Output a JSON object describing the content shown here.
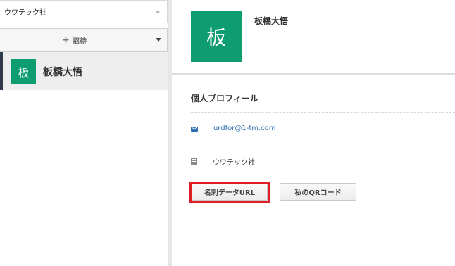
{
  "sidebar": {
    "company_select": {
      "value": "ウワテック社"
    },
    "invite": {
      "label": "招待"
    },
    "members": [
      {
        "initial": "板",
        "name": "板橋大悟",
        "selected": true
      }
    ]
  },
  "profile": {
    "initial": "板",
    "name": "板橋大悟",
    "section_title": "個人プロフィール",
    "email": "urdfor@1-tm.com",
    "company": "ウワテック社",
    "buttons": {
      "card_url": "名刺データURL",
      "qr_code": "私のQRコード"
    }
  },
  "colors": {
    "avatar": "#0d9d70",
    "link": "#2c6db1",
    "highlight": "#e01c24",
    "selected_bar": "#2f3a4a"
  },
  "icons": {
    "email": "mail-icon",
    "company": "building-icon"
  }
}
